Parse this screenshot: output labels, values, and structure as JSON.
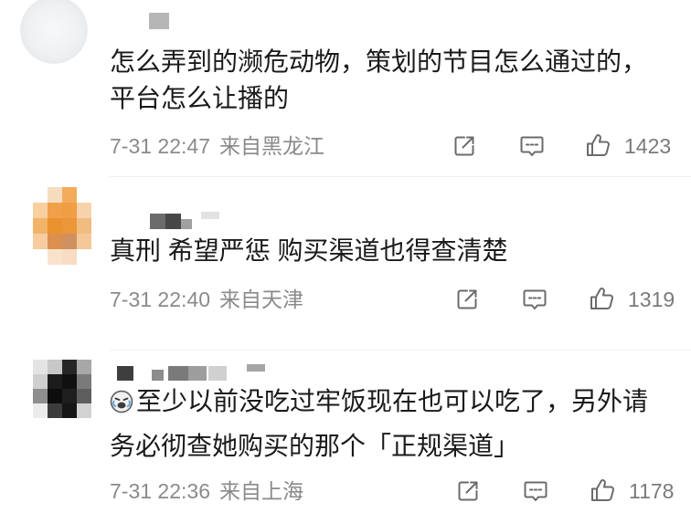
{
  "colors": {
    "text": "#1a1a1a",
    "meta": "#8a8a8a",
    "icon": "#6b6b6b"
  },
  "action_icons": {
    "share": "share-icon",
    "comment": "comment-icon",
    "like": "thumbs-up-icon"
  },
  "comments": [
    {
      "text_lines": [
        "怎么弄到的濒危动物，策划的节目怎么通过的，",
        "平台怎么让播的"
      ],
      "time": "7-31 22:47",
      "location": "来自黑龙江",
      "like_count": "1423"
    },
    {
      "text_lines": [
        "真刑 希望严惩 购买渠道也得查清楚"
      ],
      "time": "7-31 22:40",
      "location": "来自天津",
      "like_count": "1319"
    },
    {
      "emoji_icon": "laugh-cry-emoji-icon",
      "text_lines": [
        "至少以前没吃过牢饭现在也可以吃了，另外请",
        "务必彻查她购买的那个「正规渠道」"
      ],
      "time": "7-31 22:36",
      "location": "来自上海",
      "like_count": "1178"
    }
  ]
}
